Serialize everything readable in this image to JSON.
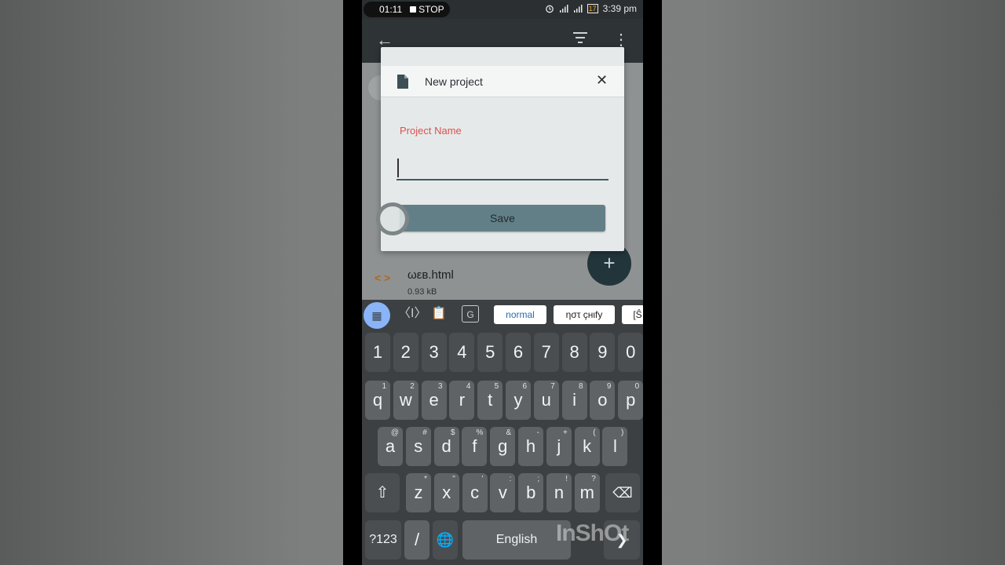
{
  "status_bar": {
    "recording_time": "01:11",
    "recording_stop": "STOP",
    "battery": "17",
    "clock": "3:39 pm"
  },
  "app_bar": {
    "back_icon": "arrow-left-icon",
    "sort_icon": "sort-icon",
    "more_icon": "more-vert-icon"
  },
  "background_list": {
    "file_name": "ωεв.html",
    "file_size": "0.93 kB"
  },
  "dialog": {
    "icon": "file-icon",
    "title": "New project",
    "close_icon": "close-icon",
    "field_label": "Project Name",
    "input_value": "",
    "save_label": "Save"
  },
  "keyboard": {
    "toolbar_chips": [
      "normal",
      "ηστ çнιfу",
      "[Ŝ"
    ],
    "number_row": [
      "1",
      "2",
      "3",
      "4",
      "5",
      "6",
      "7",
      "8",
      "9",
      "0"
    ],
    "row1": [
      {
        "k": "q",
        "h": "1"
      },
      {
        "k": "w",
        "h": "2"
      },
      {
        "k": "e",
        "h": "3"
      },
      {
        "k": "r",
        "h": "4"
      },
      {
        "k": "t",
        "h": "5"
      },
      {
        "k": "y",
        "h": "6"
      },
      {
        "k": "u",
        "h": "7"
      },
      {
        "k": "i",
        "h": "8"
      },
      {
        "k": "o",
        "h": "9"
      },
      {
        "k": "p",
        "h": "0"
      }
    ],
    "row2": [
      {
        "k": "a",
        "h": "@"
      },
      {
        "k": "s",
        "h": "#"
      },
      {
        "k": "d",
        "h": "$"
      },
      {
        "k": "f",
        "h": "%"
      },
      {
        "k": "g",
        "h": "&"
      },
      {
        "k": "h",
        "h": "-"
      },
      {
        "k": "j",
        "h": "+"
      },
      {
        "k": "k",
        "h": "("
      },
      {
        "k": "l",
        "h": ")"
      }
    ],
    "row3": [
      {
        "k": "z",
        "h": "*"
      },
      {
        "k": "x",
        "h": "\""
      },
      {
        "k": "c",
        "h": "'"
      },
      {
        "k": "v",
        "h": ":"
      },
      {
        "k": "b",
        "h": ";"
      },
      {
        "k": "n",
        "h": "!"
      },
      {
        "k": "m",
        "h": "?"
      }
    ],
    "symbols_label": "?123",
    "slash_label": "/",
    "space_label": "English"
  },
  "watermark": "InShOt",
  "colors": {
    "accent_red": "#d9534f",
    "save_button": "#627f87",
    "fab": "#22353b",
    "apps_chip": "#8ab4f8"
  }
}
